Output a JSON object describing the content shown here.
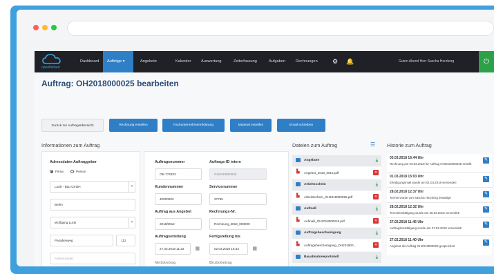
{
  "nav": {
    "logo": "openfirehert",
    "items": [
      "Dashboard",
      "Aufträge ▾",
      "Angebote",
      "Kalender",
      "Auswertung",
      "Zeiterfassung",
      "Aufgaben",
      "Rechnungen"
    ],
    "greeting": "Guten Abend Herr Sascha Herzberg"
  },
  "page": {
    "title": "Auftrag: OH2018000025 bearbeiten"
  },
  "buttons": {
    "back": "Zurück zur Auftragsübersicht",
    "invoice": "Rechnung erstellen",
    "declaration": "Fachunternehmererklärung",
    "materials": "Material erstellen",
    "email": "Email schreiben"
  },
  "sections": {
    "info": "Informationen zum Auftrag",
    "files": "Dateien zum Auftrag",
    "history": "Historie zum Auftrag"
  },
  "client": {
    "label": "Adressdaten Auftraggeber",
    "radio_firm": "Firma",
    "radio_person": "Person",
    "company": "Lucik - Bau GmbH",
    "city": "Berlin",
    "contact": "Wolfgang Lucik",
    "street": "Paradiesweg",
    "number": "112",
    "placeholder": "Adresszusatz"
  },
  "order": {
    "order_no_label": "Auftragsnummer",
    "order_no": "GE-774833",
    "order_id_label": "Auftrags-ID intern",
    "order_id": "OH2018000025",
    "customer_no_label": "Kundennummer",
    "customer_no": "40000003",
    "service_no_label": "Servicenummer",
    "service_no": "37765",
    "from_offer_label": "Auftrag aus Angebot",
    "from_offer": "2018/0012",
    "invoice_no_label": "Rechnungs-Nr.",
    "invoice_no": "Rechnung_2018_000000",
    "awarded_label": "Auftragserteilung",
    "awarded": "27.03.2018 11:32",
    "done_label": "Fertigstellung bis",
    "done": "02.03.2018 16:33",
    "cut1": "Nettobetrag",
    "cut2": "Bruttobetrag"
  },
  "files": [
    {
      "group": "Angebote",
      "file": "Angebot_2018_0012.pdf"
    },
    {
      "group": "Arbeitsschein",
      "file": "Arbeitsschein_OH2018000025.pdf"
    },
    {
      "group": "Aufmaß",
      "file": "Aufmaß_OH2018000019.pdf"
    },
    {
      "group": "Auftragsbescheinigung",
      "file": "Auftragsbescheinigung_OH201800..."
    },
    {
      "group": "Bauabnahmeprotokoll",
      "file": ""
    }
  ],
  "history": [
    {
      "time": "03.03.2018 16:44 Uhr",
      "text": "Rechnung am 03.03.2018 für Auftrag OH2018000025 erstellt"
    },
    {
      "time": "01.03.2018 15:03 Uhr",
      "text": "Erledigungsmail wurde am 01.03.2018 versendet!"
    },
    {
      "time": "28.02.2018 12:37 Uhr",
      "text": "Termin wurde von Sascha Herzberg bestätigt!"
    },
    {
      "time": "28.02.2018 12:32 Uhr",
      "text": "Terminbestätigung wurde am 28.03.2018 versendet!"
    },
    {
      "time": "27.02.2018 11:45 Uhr",
      "text": "Auftragsbestätigung wurde am 27.02.2018 versendet!"
    },
    {
      "time": "27.02.2018 11:40 Uhr",
      "text": "Angebot als Auftrag OH2018000025 gespeichert"
    }
  ],
  "colors": {
    "accent": "#2f7fc6",
    "frame": "#3fa0dd",
    "nav": "#1f2126",
    "power": "#2ca14a",
    "delete": "#d9383a"
  }
}
